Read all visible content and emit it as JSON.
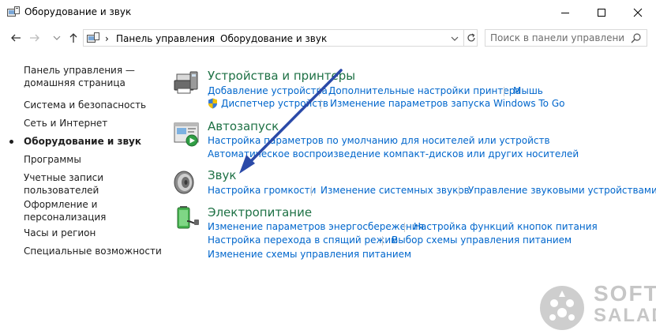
{
  "window": {
    "title": "Оборудование и звук"
  },
  "address": {
    "crumb1": "Панель управления",
    "separator": "›",
    "crumb2": "Оборудование и звук"
  },
  "search": {
    "placeholder": "Поиск в панели управления"
  },
  "sidebar": {
    "home_line1": "Панель управления —",
    "home_line2": "домашняя страница",
    "items": [
      "Система и безопасность",
      "Сеть и Интернет",
      "Оборудование и звук",
      "Программы"
    ],
    "accounts_line1": "Учетные записи",
    "accounts_line2": "пользователей",
    "appearance_line1": "Оформление и",
    "appearance_line2": "персонализация",
    "clock": "Часы и регион",
    "access": "Специальные возможности"
  },
  "categories": {
    "devices": {
      "title": "Устройства и принтеры",
      "links": [
        "Добавление устройства",
        "Дополнительные настройки принтера",
        "Мышь",
        "Диспетчер устройств",
        "Изменение параметров запуска Windows To Go"
      ]
    },
    "autoplay": {
      "title": "Автозапуск",
      "links": [
        "Настройка параметров по умолчанию для носителей или устройств",
        "Автоматическое воспроизведение компакт-дисков или других носителей"
      ]
    },
    "sound": {
      "title": "Звук",
      "links": [
        "Настройка громкости",
        "Изменение системных звуков",
        "Управление звуковыми устройствами"
      ]
    },
    "power": {
      "title": "Электропитание",
      "links": [
        "Изменение параметров энергосбережения",
        "Настройка функций кнопок питания",
        "Настройка перехода в спящий режим",
        "Выбор схемы управления питанием",
        "Изменение схемы управления питанием"
      ]
    }
  },
  "watermark": {
    "line1": "SOFT",
    "line2": "SALAD"
  },
  "colors": {
    "category_green": "#1e7145",
    "link_blue": "#0066cc",
    "arrow_blue": "#2b4aa8"
  }
}
